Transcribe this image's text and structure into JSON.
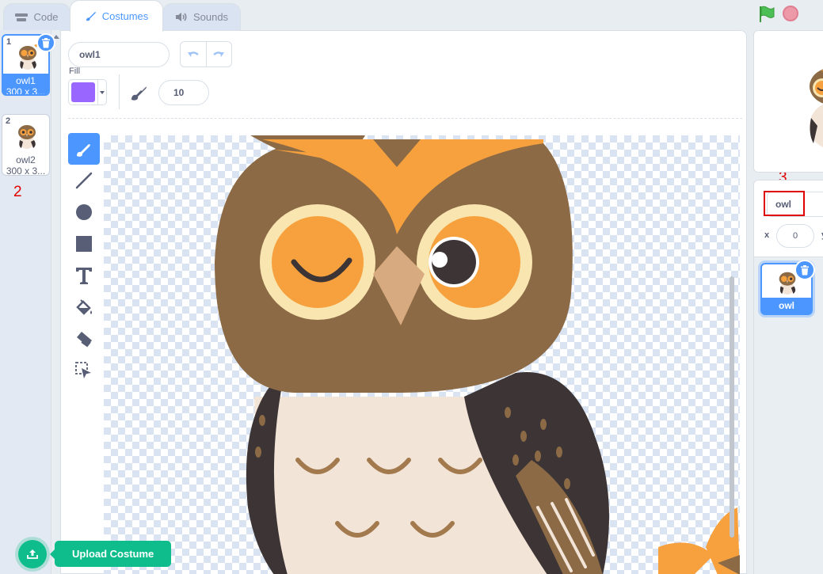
{
  "tabs": [
    {
      "label": "Code",
      "icon": "code-blocks-icon"
    },
    {
      "label": "Costumes",
      "icon": "paintbrush-icon"
    },
    {
      "label": "Sounds",
      "icon": "speaker-icon"
    }
  ],
  "controls": {
    "green_flag": "green-flag-icon",
    "stop": "stop-icon"
  },
  "costumes": [
    {
      "number": "1",
      "name": "owl1",
      "size": "300 x 3...",
      "selected": true
    },
    {
      "number": "2",
      "name": "owl2",
      "size": "300 x 3...",
      "selected": false
    }
  ],
  "upload": {
    "tooltip": "Upload Costume"
  },
  "annotations": {
    "one": "1",
    "two": "2",
    "three": "3"
  },
  "editor": {
    "costume_name": "owl1",
    "fill_label": "Fill",
    "fill_color": "#9966ff",
    "brush_size": "10"
  },
  "tools": [
    "brush-tool",
    "line-tool",
    "circle-tool",
    "rectangle-tool",
    "text-tool",
    "fill-tool",
    "eraser-tool",
    "select-tool"
  ],
  "sprite": {
    "name": "owl",
    "x_label": "x",
    "x_value": "0",
    "y_label": "y",
    "tile_name": "owl"
  },
  "colors": {
    "accent": "#4c97ff",
    "upload": "#0fbd8c",
    "annotation": "#e00000"
  }
}
